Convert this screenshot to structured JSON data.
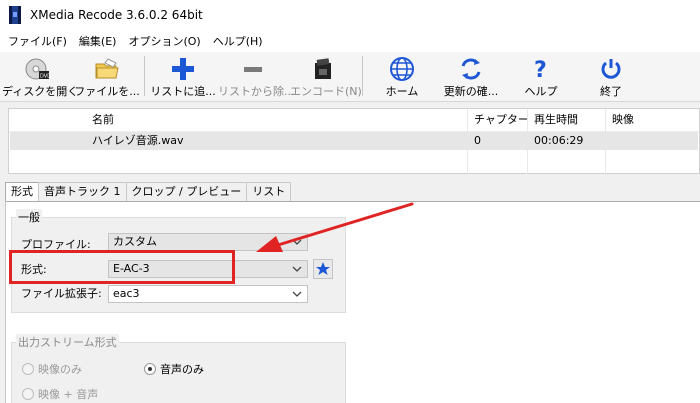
{
  "window": {
    "title": "XMedia Recode 3.6.0.2 64bit"
  },
  "menu": {
    "items": [
      "ファイル(F)",
      "編集(E)",
      "オプション(O)",
      "ヘルプ(H)"
    ]
  },
  "toolbar": {
    "open_disc": "ディスクを開く",
    "open_file": "ファイルを...",
    "add_list": "リストに追...",
    "remove_list": "リストから除...",
    "encode": "エンコード(N)",
    "home": "ホーム",
    "update": "更新の確...",
    "help": "ヘルプ",
    "exit": "終了"
  },
  "filetable": {
    "headers": {
      "name": "名前",
      "chapter": "チャプター",
      "duration": "再生時間",
      "video": "映像"
    },
    "rows": [
      {
        "name": "ハイレゾ音源.wav",
        "chapter": "0",
        "duration": "00:06:29",
        "video": ""
      }
    ]
  },
  "tabs": {
    "format": "形式",
    "audio": "音声トラック 1",
    "crop": "クロップ / プレビュー",
    "list": "リスト"
  },
  "general": {
    "title": "一般",
    "profile_label": "プロファイル:",
    "profile_value": "カスタム",
    "format_label": "形式:",
    "format_value": "E-AC-3",
    "ext_label": "ファイル拡張子:",
    "ext_value": "eac3"
  },
  "output_stream": {
    "title": "出力ストリーム形式",
    "video_only": "映像のみ",
    "audio_only": "音声のみ",
    "video_audio": "映像 + 音声"
  },
  "colors": {
    "annotation": "#e02424",
    "accent_blue": "#1e57d6"
  }
}
